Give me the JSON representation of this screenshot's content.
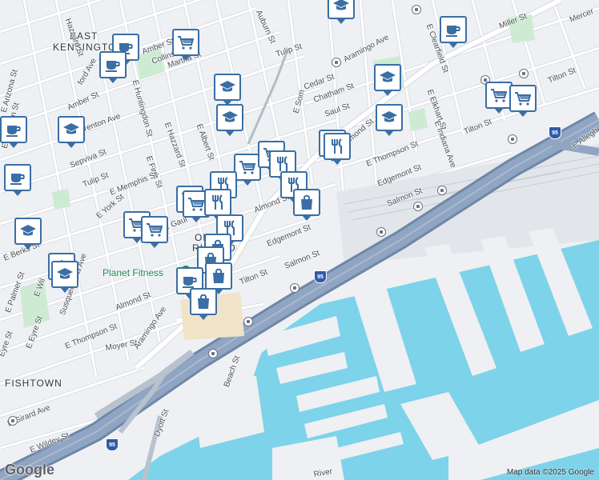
{
  "map": {
    "attribution": "Map data ©2025 Google",
    "logo": "Google",
    "colors": {
      "water": "#7dd3ea",
      "land": "#eef0f3",
      "street": "#ffffff",
      "street_outline": "#d5d9df",
      "highway": "#8fa5c2",
      "highway_dark": "#6f87a8",
      "park": "#cdebd3",
      "pin_border": "#3a6ea5"
    }
  },
  "areas": [
    {
      "name": "east-kensington",
      "text": "EAST"
    },
    {
      "name": "east-kensington-2",
      "text": "KENSINGTON"
    },
    {
      "name": "fishtown",
      "text": "FISHTOWN"
    },
    {
      "name": "olde-richmond",
      "text": "OLDE"
    },
    {
      "name": "olde-richmond-2",
      "text": "RICHMO"
    }
  ],
  "poi": {
    "planet_fitness": "Planet Fitness"
  },
  "streets": [
    "Hazzard St",
    "Auburn St",
    "Aramingo Ave",
    "Tulip St",
    "Amber St",
    "Collins St",
    "Martha St",
    "E Huntingdon St",
    "Cedar St",
    "Chatham St",
    "E Clearfield St",
    "E Elkhart St",
    "E Indiana Ave",
    "Tilton St",
    "I-95",
    "E Allegheny",
    "Amber St",
    "ford Ave",
    "Trenton Ave",
    "E Hazzard St",
    "E Albert St",
    "Sepviva St",
    "E Firth St",
    "Tulip St",
    "E Memphis St",
    "E York St",
    "E Arizona St",
    "E Dauphin St",
    "E Berks St",
    "E Wil",
    "Susquehanna Ave",
    "Almond St",
    "E Palmer St",
    "E Eyre St",
    "E Thompson St",
    "Moyer St",
    "Eyre St",
    "Tulip St",
    "E Girard Ave",
    "E Wildey St",
    "Beach St",
    "Dyott St",
    "Salmon St",
    "Edgemont St",
    "E Thompson St",
    "Almond St",
    "Salmon St",
    "Tilton St",
    "Almond St",
    "Gaul St",
    "Saul St",
    "E Som",
    "Chatham St",
    "Cedar St",
    "E Sergeant",
    "Gaul St",
    "Miller St",
    "Mercer",
    "Edgemont St",
    "Salmon St",
    "River",
    "E Gaul"
  ],
  "pins": [
    {
      "name": "school-pin",
      "icon": "school"
    },
    {
      "name": "coffee-pin",
      "icon": "coffee"
    },
    {
      "name": "coffee-pin",
      "icon": "coffee"
    },
    {
      "name": "grocery-pin",
      "icon": "grocery"
    },
    {
      "name": "coffee-pin",
      "icon": "coffee"
    },
    {
      "name": "school-pin",
      "icon": "school"
    },
    {
      "name": "school-pin",
      "icon": "school"
    },
    {
      "name": "school-pin",
      "icon": "school"
    },
    {
      "name": "coffee-pin",
      "icon": "coffee"
    },
    {
      "name": "school-pin",
      "icon": "school"
    },
    {
      "name": "coffee-pin",
      "icon": "coffee"
    },
    {
      "name": "school-pin",
      "icon": "school"
    },
    {
      "name": "restaurant-pin",
      "icon": "restaurant"
    },
    {
      "name": "restaurant-pin",
      "icon": "restaurant"
    },
    {
      "name": "grocery-pin",
      "icon": "grocery"
    },
    {
      "name": "grocery-pin",
      "icon": "grocery"
    },
    {
      "name": "restaurant-pin",
      "icon": "restaurant"
    },
    {
      "name": "restaurant-pin",
      "icon": "restaurant"
    },
    {
      "name": "grocery-pin",
      "icon": "grocery"
    },
    {
      "name": "grocery-pin",
      "icon": "grocery"
    },
    {
      "name": "restaurant-pin",
      "icon": "restaurant"
    },
    {
      "name": "restaurant-pin",
      "icon": "restaurant"
    },
    {
      "name": "shopping-pin",
      "icon": "shopping"
    },
    {
      "name": "grocery-pin",
      "icon": "grocery"
    },
    {
      "name": "grocery-pin",
      "icon": "grocery"
    },
    {
      "name": "restaurant-pin",
      "icon": "restaurant"
    },
    {
      "name": "shopping-pin",
      "icon": "shopping"
    },
    {
      "name": "shopping-pin",
      "icon": "shopping"
    },
    {
      "name": "coffee-pin",
      "icon": "coffee"
    },
    {
      "name": "shopping-pin",
      "icon": "shopping"
    },
    {
      "name": "school-pin",
      "icon": "school"
    },
    {
      "name": "school-pin",
      "icon": "school"
    },
    {
      "name": "school-pin",
      "icon": "school"
    },
    {
      "name": "grocery-pin",
      "icon": "grocery"
    },
    {
      "name": "grocery-pin",
      "icon": "grocery"
    },
    {
      "name": "shopping-pin",
      "icon": "shopping"
    }
  ],
  "interstate": "95"
}
